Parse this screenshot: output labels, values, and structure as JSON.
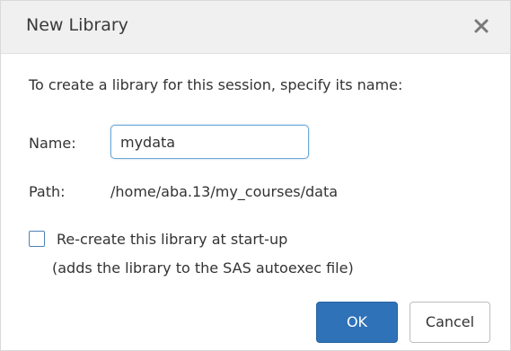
{
  "dialog": {
    "title": "New Library",
    "close_icon": "close-icon",
    "instructions": "To create a library for this session, specify its name:"
  },
  "form": {
    "name_label": "Name:",
    "name_value": "mydata",
    "path_label": "Path:",
    "path_value": "/home/aba.13/my_courses/data"
  },
  "option": {
    "checked": false,
    "label": "Re-create this library at start-up",
    "note": "(adds the library to the SAS autoexec file)"
  },
  "buttons": {
    "ok_label": "OK",
    "cancel_label": "Cancel"
  },
  "colors": {
    "header_bg": "#f0f0f0",
    "primary_button": "#2f72b8",
    "input_focus_border": "#6aa8d8",
    "checkbox_border": "#4d82b8"
  }
}
